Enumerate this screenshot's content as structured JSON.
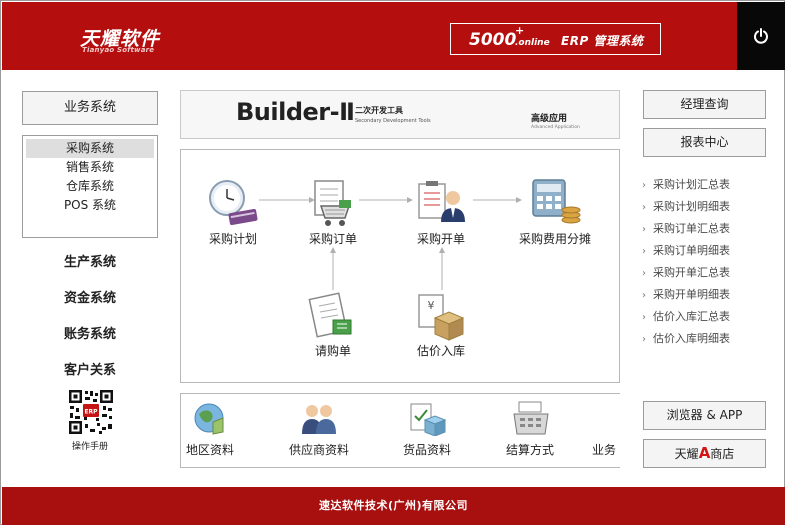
{
  "header": {
    "brand": "天耀软件",
    "brand_en": "Tianyao Software",
    "product_number": "5000",
    "product_plus": "+",
    "product_online": ".online",
    "product_name": "ERP 管理系统",
    "power_icon": "power-icon"
  },
  "left": {
    "business_button": "业务系统",
    "business_items": [
      {
        "label": "采购系统",
        "active": true
      },
      {
        "label": "销售系统",
        "active": false
      },
      {
        "label": "仓库系统",
        "active": false
      },
      {
        "label": "POS 系统",
        "active": false
      }
    ],
    "nav": [
      "生产系统",
      "资金系统",
      "账务系统",
      "客户关系"
    ],
    "qr_badge": "ERP",
    "manual": "操作手册"
  },
  "banner": {
    "title": "Builder-Ⅱ",
    "tag": "二次开发工具",
    "tag_en": "Secondary Development Tools",
    "advanced": "高级应用",
    "advanced_en": "Advanced Application"
  },
  "flow": {
    "purchase_plan": "采购计划",
    "purchase_order": "采购订单",
    "purchase_invoice": "采购开单",
    "cost_allocation": "采购费用分摊",
    "requisition": "请购单",
    "estimated_stock_in": "估价入库"
  },
  "strip": [
    "地区资料",
    "供应商资料",
    "货品资料",
    "结算方式",
    "业务"
  ],
  "right": {
    "manager_query": "经理查询",
    "report_center": "报表中心",
    "reports": [
      "采购计划汇总表",
      "采购计划明细表",
      "采购订单汇总表",
      "采购订单明细表",
      "采购开单汇总表",
      "采购开单明细表",
      "估价入库汇总表",
      "估价入库明细表"
    ],
    "chevron": "›",
    "browser_app": "浏览器 & APP",
    "store_prefix": "天耀",
    "store_a": "A",
    "store_suffix": "商店"
  },
  "footer": {
    "company": "速达软件技术(广州)有限公司"
  },
  "colors": {
    "header_red": "#b50e0e",
    "footer_red": "#a80f0f",
    "power_black": "#080808",
    "accent_a": "#d21414"
  }
}
